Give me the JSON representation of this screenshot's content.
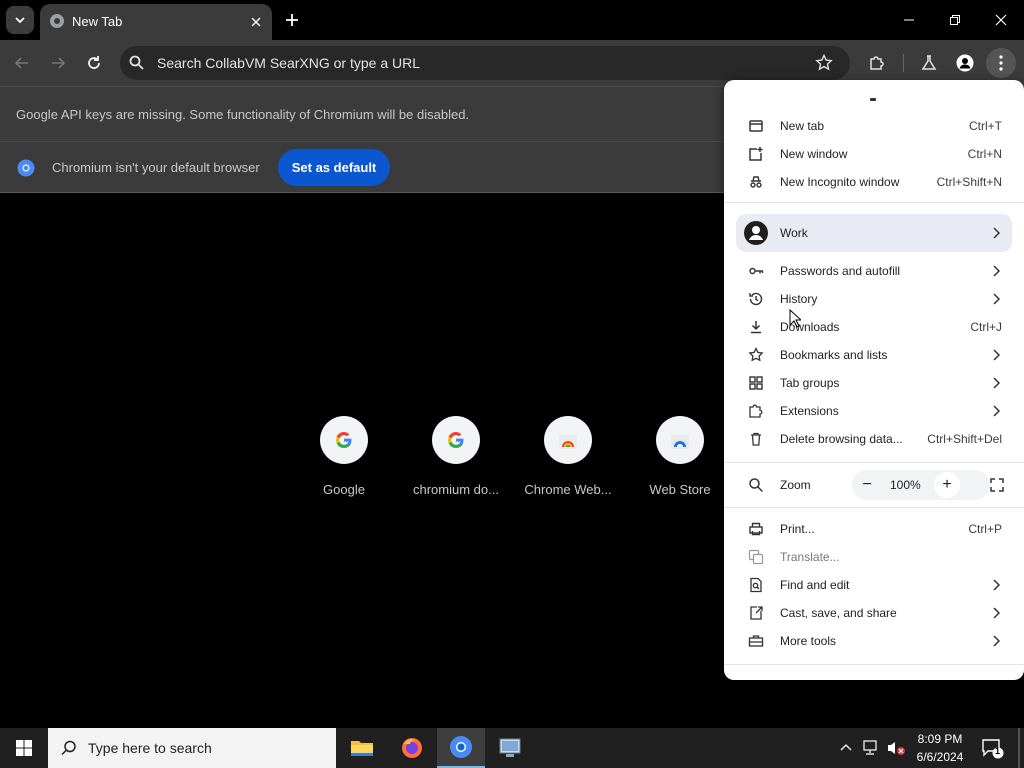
{
  "window": {
    "tab_title": "New Tab",
    "minimize": "minimize",
    "maximize": "maximize",
    "close": "close"
  },
  "toolbar": {
    "omnibox_text": "Search CollabVM SearXNG or type a URL"
  },
  "infobars": {
    "api_keys_message": "Google API keys are missing. Some functionality of Chromium will be disabled.",
    "default_browser_message": "Chromium isn't your default browser",
    "set_default_label": "Set as default"
  },
  "shortcuts": [
    {
      "label": "Google",
      "icon": "google-icon"
    },
    {
      "label": "chromium do...",
      "icon": "google-icon"
    },
    {
      "label": "Chrome Web...",
      "icon": "chrome-web-store-icon"
    },
    {
      "label": "Web Store",
      "icon": "web-store-icon"
    }
  ],
  "menu": {
    "new_tab": {
      "label": "New tab",
      "shortcut": "Ctrl+T"
    },
    "new_window": {
      "label": "New window",
      "shortcut": "Ctrl+N"
    },
    "new_incognito": {
      "label": "New Incognito window",
      "shortcut": "Ctrl+Shift+N"
    },
    "profile": {
      "label": "Work"
    },
    "passwords": {
      "label": "Passwords and autofill"
    },
    "history": {
      "label": "History"
    },
    "downloads": {
      "label": "Downloads",
      "shortcut": "Ctrl+J"
    },
    "bookmarks": {
      "label": "Bookmarks and lists"
    },
    "tab_groups": {
      "label": "Tab groups"
    },
    "extensions": {
      "label": "Extensions"
    },
    "delete_data": {
      "label": "Delete browsing data...",
      "shortcut": "Ctrl+Shift+Del"
    },
    "zoom": {
      "label": "Zoom",
      "minus": "−",
      "value": "100%",
      "plus": "+"
    },
    "print": {
      "label": "Print...",
      "shortcut": "Ctrl+P"
    },
    "translate": {
      "label": "Translate..."
    },
    "find_edit": {
      "label": "Find and edit"
    },
    "cast_save": {
      "label": "Cast, save, and share"
    },
    "more_tools": {
      "label": "More tools"
    }
  },
  "taskbar": {
    "search_placeholder": "Type here to search",
    "time": "8:09 PM",
    "date": "6/6/2024",
    "notification_count": "1"
  },
  "colors": {
    "accent": "#0b57d0",
    "toolbar": "#3b3b3b",
    "menu_bg": "#ffffff"
  }
}
